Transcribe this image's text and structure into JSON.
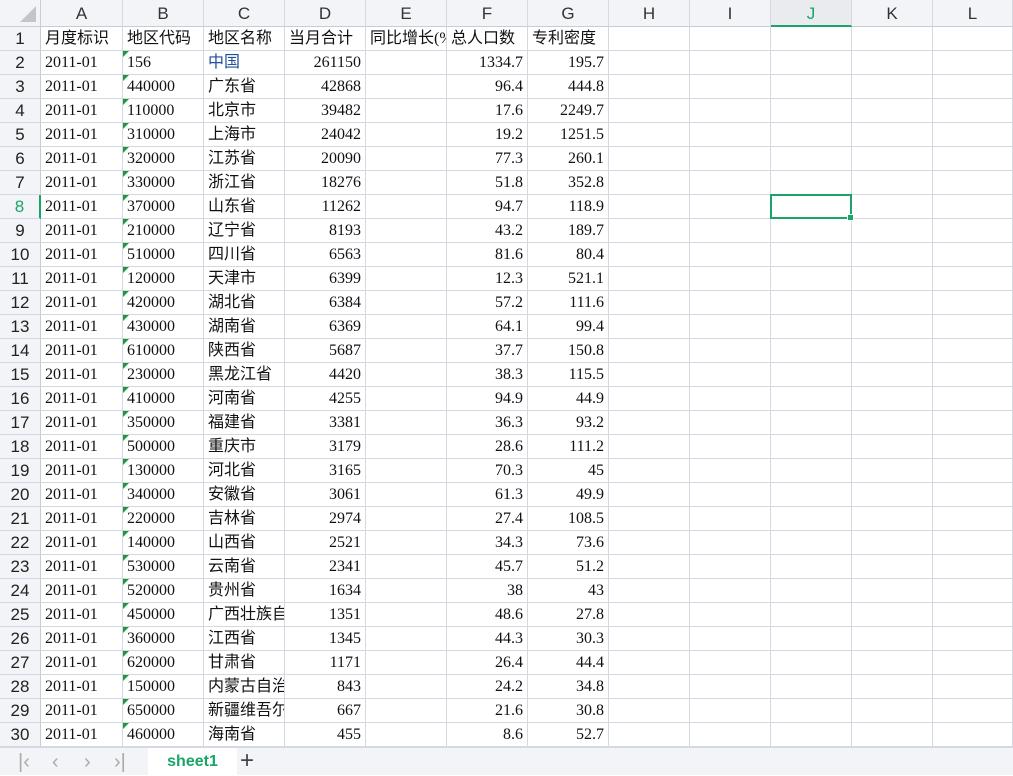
{
  "columns": [
    "A",
    "B",
    "C",
    "D",
    "E",
    "F",
    "G",
    "H",
    "I",
    "J",
    "K",
    "L"
  ],
  "selected": {
    "col": "J",
    "row": 8
  },
  "header": [
    "月度标识",
    "地区代码",
    "地区名称",
    "当月合计",
    "同比增长(%)",
    "总人口数",
    "专利密度"
  ],
  "rows": [
    [
      "2011-01",
      "156",
      "中国",
      "261150",
      "",
      "1334.7",
      "195.7"
    ],
    [
      "2011-01",
      "440000",
      "广东省",
      "42868",
      "",
      "96.4",
      "444.8"
    ],
    [
      "2011-01",
      "110000",
      "北京市",
      "39482",
      "",
      "17.6",
      "2249.7"
    ],
    [
      "2011-01",
      "310000",
      "上海市",
      "24042",
      "",
      "19.2",
      "1251.5"
    ],
    [
      "2011-01",
      "320000",
      "江苏省",
      "20090",
      "",
      "77.3",
      "260.1"
    ],
    [
      "2011-01",
      "330000",
      "浙江省",
      "18276",
      "",
      "51.8",
      "352.8"
    ],
    [
      "2011-01",
      "370000",
      "山东省",
      "11262",
      "",
      "94.7",
      "118.9"
    ],
    [
      "2011-01",
      "210000",
      "辽宁省",
      "8193",
      "",
      "43.2",
      "189.7"
    ],
    [
      "2011-01",
      "510000",
      "四川省",
      "6563",
      "",
      "81.6",
      "80.4"
    ],
    [
      "2011-01",
      "120000",
      "天津市",
      "6399",
      "",
      "12.3",
      "521.1"
    ],
    [
      "2011-01",
      "420000",
      "湖北省",
      "6384",
      "",
      "57.2",
      "111.6"
    ],
    [
      "2011-01",
      "430000",
      "湖南省",
      "6369",
      "",
      "64.1",
      "99.4"
    ],
    [
      "2011-01",
      "610000",
      "陕西省",
      "5687",
      "",
      "37.7",
      "150.8"
    ],
    [
      "2011-01",
      "230000",
      "黑龙江省",
      "4420",
      "",
      "38.3",
      "115.5"
    ],
    [
      "2011-01",
      "410000",
      "河南省",
      "4255",
      "",
      "94.9",
      "44.9"
    ],
    [
      "2011-01",
      "350000",
      "福建省",
      "3381",
      "",
      "36.3",
      "93.2"
    ],
    [
      "2011-01",
      "500000",
      "重庆市",
      "3179",
      "",
      "28.6",
      "111.2"
    ],
    [
      "2011-01",
      "130000",
      "河北省",
      "3165",
      "",
      "70.3",
      "45"
    ],
    [
      "2011-01",
      "340000",
      "安徽省",
      "3061",
      "",
      "61.3",
      "49.9"
    ],
    [
      "2011-01",
      "220000",
      "吉林省",
      "2974",
      "",
      "27.4",
      "108.5"
    ],
    [
      "2011-01",
      "140000",
      "山西省",
      "2521",
      "",
      "34.3",
      "73.6"
    ],
    [
      "2011-01",
      "530000",
      "云南省",
      "2341",
      "",
      "45.7",
      "51.2"
    ],
    [
      "2011-01",
      "520000",
      "贵州省",
      "1634",
      "",
      "38",
      "43"
    ],
    [
      "2011-01",
      "450000",
      "广西壮族自治区",
      "1351",
      "",
      "48.6",
      "27.8"
    ],
    [
      "2011-01",
      "360000",
      "江西省",
      "1345",
      "",
      "44.3",
      "30.3"
    ],
    [
      "2011-01",
      "620000",
      "甘肃省",
      "1171",
      "",
      "26.4",
      "44.4"
    ],
    [
      "2011-01",
      "150000",
      "内蒙古自治区",
      "843",
      "",
      "24.2",
      "34.8"
    ],
    [
      "2011-01",
      "650000",
      "新疆维吾尔自治区",
      "667",
      "",
      "21.6",
      "30.8"
    ],
    [
      "2011-01",
      "460000",
      "海南省",
      "455",
      "",
      "8.6",
      "52.7"
    ]
  ],
  "sheet_tab": "sheet1",
  "add_sheet_label": "+",
  "nav_icons": [
    "first-sheet-icon",
    "prev-sheet-icon",
    "next-sheet-icon",
    "last-sheet-icon"
  ]
}
